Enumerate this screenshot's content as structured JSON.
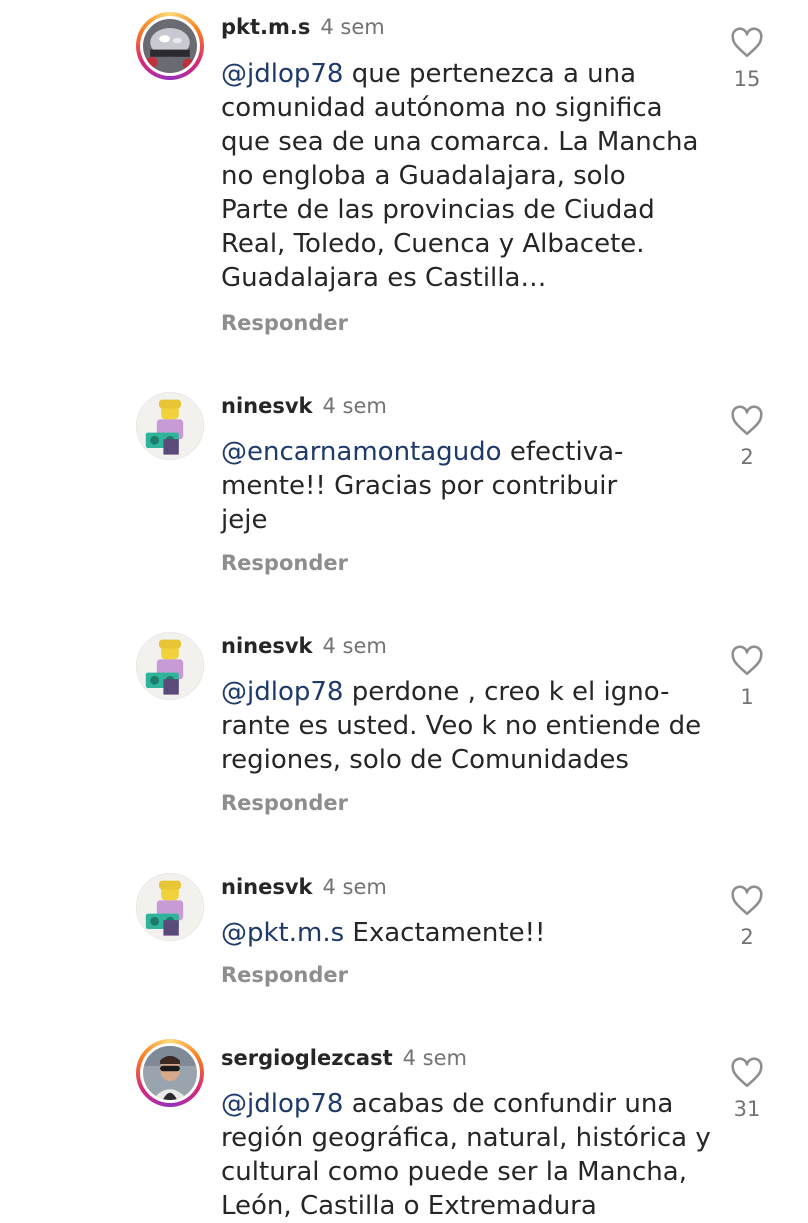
{
  "comments": [
    {
      "username": "pkt.m.s",
      "time": "4 sem",
      "mention": "@jdlop78",
      "text": " que pertenezca a una\ncomunidad autónoma no significa\nque sea de una comarca. La Mancha\nno engloba a Guadalajara, solo\nParte de las provincias de Ciudad\nReal, Toledo, Cuenca y Albacete.\nGuadalajara es Castilla…",
      "reply": "Responder",
      "likes": "15",
      "avatar": "helmet-avatar"
    },
    {
      "username": "ninesvk",
      "time": "4 sem",
      "mention": "@encarnamontagudo",
      "text": " efectiva-\nmente!! Gracias por contribuir\njeje",
      "reply": "Responder",
      "likes": "2",
      "avatar": "lego-figure-avatar"
    },
    {
      "username": "ninesvk",
      "time": "4 sem",
      "mention": "@jdlop78",
      "text": " perdone , creo k el igno-\nrante es usted. Veo k no entiende de\nregiones, solo de Comunidades",
      "reply": "Responder",
      "likes": "1",
      "avatar": "lego-figure-avatar"
    },
    {
      "username": "ninesvk",
      "time": "4 sem",
      "mention": "@pkt.m.s",
      "text": " Exactamente!!",
      "reply": "Responder",
      "likes": "2",
      "avatar": "lego-figure-avatar"
    },
    {
      "username": "sergioglezcast",
      "time": "4 sem",
      "mention": "@jdlop78",
      "text": " acabas de confundir una\nregión geográfica, natural, histórica y\ncultural como puede ser la Mancha,\nLeón, Castilla o Extremadura",
      "reply": "Responder",
      "likes": "31",
      "avatar": "person-photo-avatar"
    }
  ],
  "colors": {
    "text": "#262626",
    "secondary": "#737373",
    "mention": "#1e3a6b",
    "reply": "#8e8e8e"
  }
}
